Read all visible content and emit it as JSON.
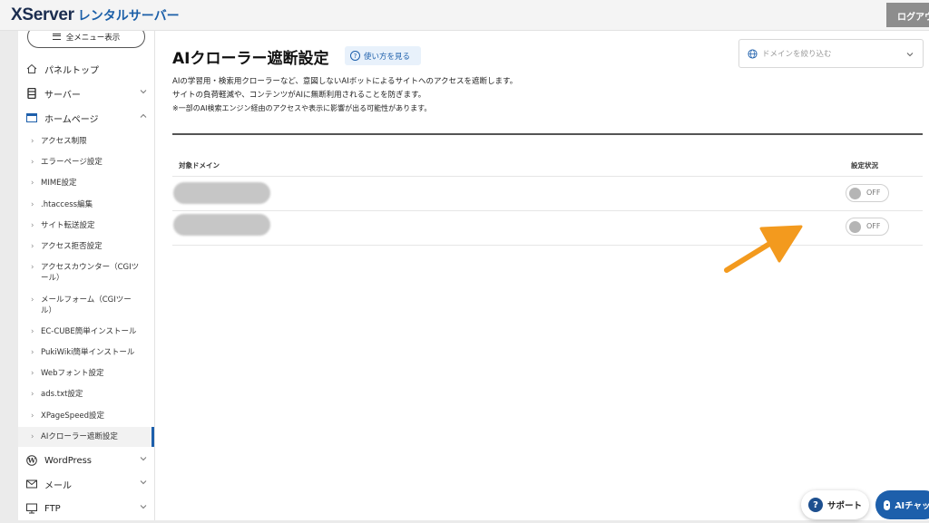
{
  "header": {
    "brand": "XServer",
    "brand_sub": "レンタルサーバー",
    "logout_label": "ログアウト"
  },
  "sidebar": {
    "menu_all_label": "全メニュー表示",
    "nav_top": [
      {
        "label": "パネルトップ",
        "icon": "home-icon"
      },
      {
        "label": "サーバー",
        "icon": "server-icon"
      },
      {
        "label": "ホームページ",
        "icon": "browser-window-icon"
      }
    ],
    "homepage_items": [
      {
        "label": "アクセス制限"
      },
      {
        "label": "エラーページ設定"
      },
      {
        "label": "MIME設定"
      },
      {
        "label": ".htaccess編集"
      },
      {
        "label": "サイト転送設定"
      },
      {
        "label": "アクセス拒否設定"
      },
      {
        "label_line1": "アクセスカウンター（CGIツ",
        "label_line2": "ール）"
      },
      {
        "label_line1": "メールフォーム（CGIツー",
        "label_line2": "ル）"
      },
      {
        "label": "EC-CUBE簡単インストール"
      },
      {
        "label": "PukiWiki簡単インストール"
      },
      {
        "label": "Webフォント設定"
      },
      {
        "label": "ads.txt設定"
      },
      {
        "label": "XPageSpeed設定"
      },
      {
        "label": "AIクローラー遮断設定"
      }
    ],
    "nav_bottom": [
      {
        "label": "WordPress",
        "icon": "wordpress-icon"
      },
      {
        "label": "メール",
        "icon": "mail-icon"
      },
      {
        "label": "FTP",
        "icon": "monitor-icon"
      }
    ]
  },
  "main": {
    "title": "AIクローラー遮断設定",
    "howto_label": "使い方を見る",
    "domain_filter_placeholder": "ドメインを絞り込む",
    "description": [
      "AIの学習用・検索用クローラーなど、意図しないAIボットによるサイトへのアクセスを遮断します。",
      "サイトの負荷軽減や、コンテンツがAIに無断利用されることを防ぎます。"
    ],
    "note": "※一部のAI検索エンジン経由のアクセスや表示に影響が出る可能性があります。",
    "table": {
      "col_domain": "対象ドメイン",
      "col_status": "設定状況",
      "rows": [
        {
          "status": "OFF"
        },
        {
          "status": "OFF"
        }
      ]
    }
  },
  "floating": {
    "support_label": "サポート",
    "ai_chat_label": "AIチャット"
  },
  "colors": {
    "accent": "#1d5fab",
    "annotation_arrow": "#f39a1e"
  }
}
